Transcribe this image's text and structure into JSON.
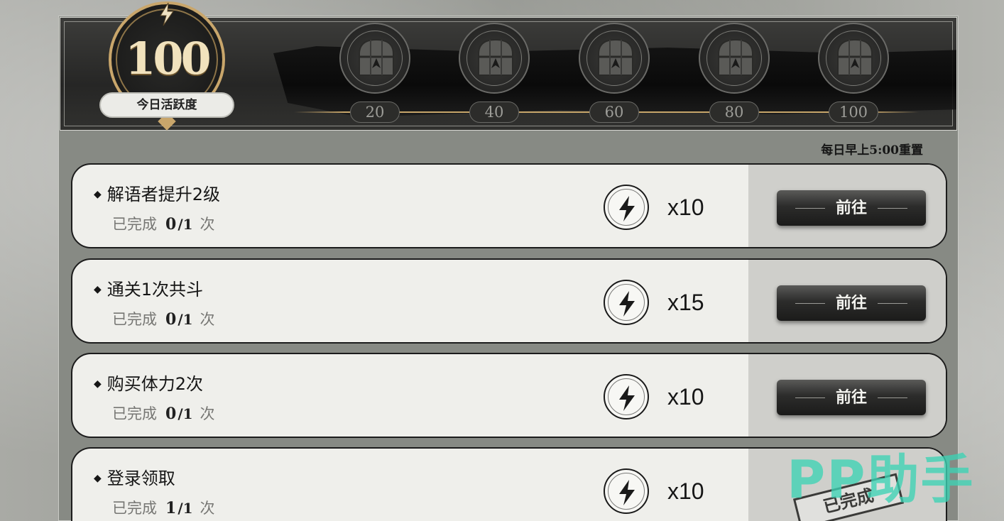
{
  "header": {
    "activity_points": "100",
    "activity_label": "今日活跃度",
    "thresholds": [
      "20",
      "40",
      "60",
      "80",
      "100"
    ],
    "reset_note": "每日早上5:00重置"
  },
  "tasks": [
    {
      "title": "解语者提升2级",
      "progress_label": "已完成",
      "progress_current": "0",
      "progress_total": "/1",
      "progress_unit": "次",
      "reward_qty": "x10",
      "action_label": "前往"
    },
    {
      "title": "通关1次共斗",
      "progress_label": "已完成",
      "progress_current": "0",
      "progress_total": "/1",
      "progress_unit": "次",
      "reward_qty": "x15",
      "action_label": "前往"
    },
    {
      "title": "购买体力2次",
      "progress_label": "已完成",
      "progress_current": "0",
      "progress_total": "/1",
      "progress_unit": "次",
      "reward_qty": "x10",
      "action_label": "前往"
    },
    {
      "title": "登录领取",
      "progress_label": "已完成",
      "progress_current": "1",
      "progress_total": "/1",
      "progress_unit": "次",
      "reward_qty": "x10",
      "completed_stamp": "已完成"
    }
  ],
  "watermark": "PP助手",
  "icons": {
    "chest": "treasure-chest-icon",
    "reward": "activity-bolt-icon",
    "badge": "bolt-emblem-icon"
  },
  "colors": {
    "gold_accent": "#c9a66b",
    "panel_bg": "#878a84",
    "row_bg": "#efefeb",
    "watermark": "#3cd2b4"
  }
}
